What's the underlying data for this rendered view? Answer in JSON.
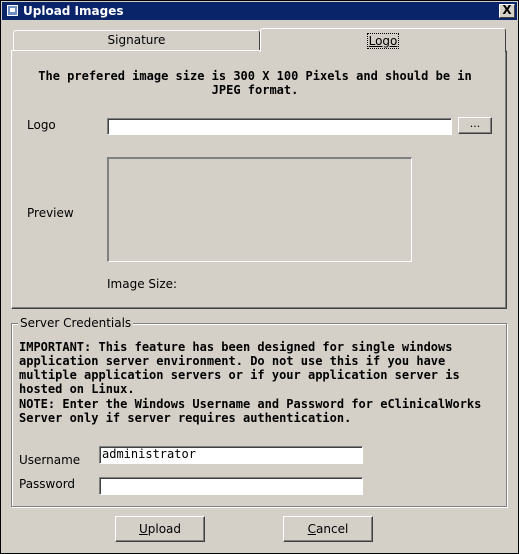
{
  "window": {
    "title": "Upload Images",
    "close_glyph": "X"
  },
  "tabs": [
    {
      "label": "Signature",
      "selected": false
    },
    {
      "label": "Logo",
      "selected": true
    }
  ],
  "logo_panel": {
    "info_text": "The prefered image size is 300 X 100 Pixels and should be in JPEG format.",
    "logo_label": "Logo",
    "logo_value": "",
    "browse_label": "...",
    "preview_label": "Preview",
    "image_size_label": "Image Size:"
  },
  "server_credentials": {
    "title": "Server Credentials",
    "important_text": "IMPORTANT: This feature has been designed for single windows application server environment. Do not use this if you have multiple application servers or if your application server is hosted on Linux.",
    "note_text": "NOTE: Enter the Windows Username and Password for eClinicalWorks Server only if server requires authentication.",
    "username_label": "Username",
    "username_value": "administrator",
    "password_label": "Password",
    "password_value": ""
  },
  "buttons": {
    "upload": "Upload",
    "cancel": "Cancel"
  },
  "icons": {
    "app": "window-app-icon",
    "close": "close-icon"
  }
}
